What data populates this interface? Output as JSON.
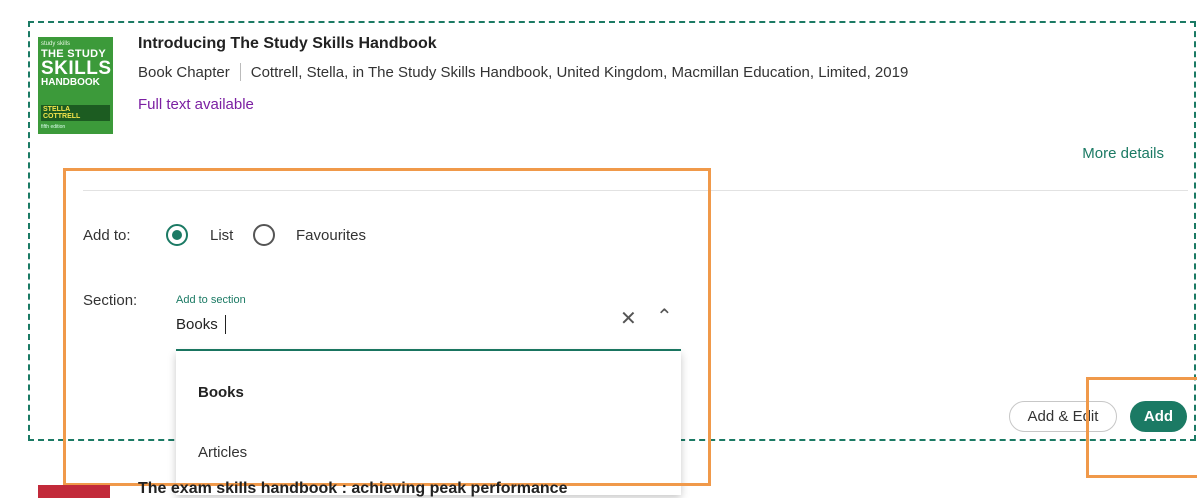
{
  "result": {
    "cover": {
      "top_small": "study skills",
      "line1": "THE STUDY",
      "line2": "SKILLS",
      "line3": "HANDBOOK",
      "author": "STELLA COTTRELL",
      "edition": "fifth edition"
    },
    "title": "Introducing The Study Skills Handbook",
    "type": "Book Chapter",
    "citation": "Cottrell, Stella, in The Study Skills Handbook, United Kingdom, Macmillan Education, Limited, 2019",
    "availability": "Full text available",
    "more_details": "More details"
  },
  "form": {
    "add_to_label": "Add to:",
    "options": [
      "List",
      "Favourites"
    ],
    "selected_option": "List",
    "section_label": "Section:",
    "section_field": {
      "label": "Add to section",
      "value": "Books"
    },
    "dropdown": [
      "Books",
      "Articles"
    ],
    "buttons": {
      "add_edit": "Add & Edit",
      "add": "Add"
    }
  },
  "next_result": {
    "title": "The exam skills handbook : achieving peak performance"
  },
  "icons": {
    "clear": "close-icon",
    "toggle": "chevron-up-icon"
  },
  "colors": {
    "accent": "#1b7a64",
    "availability": "#7b1fa2",
    "highlight": "#f0994a"
  }
}
